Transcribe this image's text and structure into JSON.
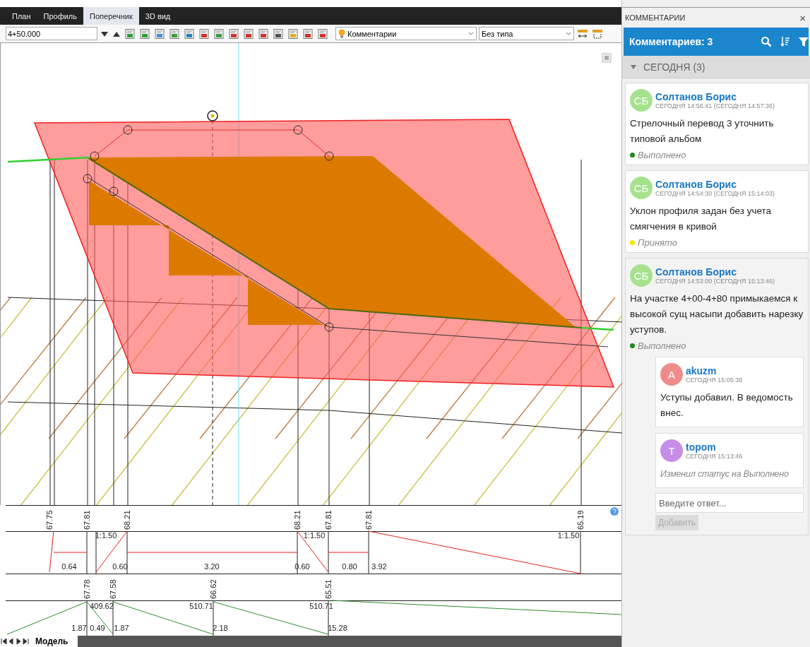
{
  "view_tabs": [
    {
      "label": "План",
      "selected": false
    },
    {
      "label": "Профиль",
      "selected": false
    },
    {
      "label": "Поперечник",
      "selected": true
    },
    {
      "label": "3D вид",
      "selected": false
    }
  ],
  "toolbar": {
    "station": "4+50.000",
    "layer_dropdown": "Комментарии",
    "type_dropdown": "Без типа"
  },
  "bands": [
    {
      "elevations": [
        "67.75",
        "67.81",
        "68.21",
        "68.21",
        "67.81",
        "67.81",
        "65.19"
      ],
      "slopes": [
        "1:1.50",
        "1:1.50",
        "1:1.50"
      ],
      "lengths": [
        "0.64",
        "0.60",
        "3.20",
        "0.60",
        "0.80",
        "3.92"
      ]
    },
    {
      "elevations": [
        "67.78",
        "67.58",
        "66.62",
        "65.51"
      ],
      "slopes": [
        "409.62",
        "510.71",
        "510.71"
      ],
      "lengths": [
        "1.87",
        "0.49",
        "1.87",
        "2.18",
        "15.28"
      ]
    }
  ],
  "sheet_tabs": [
    {
      "label": "Модель",
      "selected": true
    }
  ],
  "comments_panel": {
    "title": "КОММЕНТАРИИ",
    "close": "×",
    "count_label": "Комментариев: 3",
    "groups": [
      {
        "label": "СЕГОДНЯ (3)",
        "expanded": true,
        "comments": [
          {
            "initials": "СБ",
            "color": "#a6e28e",
            "author": "Солтанов Борис",
            "time": "СЕГОДНЯ 14:56:41 (СЕГОДНЯ 14:57:36)",
            "text": "Стрелочный перевод 3 уточнить типовой альбом",
            "status": {
              "text": "Выполнено",
              "color": "#1a8c1a"
            },
            "selected": false
          },
          {
            "initials": "СБ",
            "color": "#a6e28e",
            "author": "Солтанов Борис",
            "time": "СЕГОДНЯ 14:54:30 (СЕГОДНЯ 15:14:03)",
            "text": "Уклон профиля задан без учета смягчения в кривой",
            "status": {
              "text": "Принято",
              "color": "#f2e600"
            },
            "selected": false
          },
          {
            "initials": "СБ",
            "color": "#a6e28e",
            "author": "Солтанов Борис",
            "time": "СЕГОДНЯ 14:53:00 (СЕГОДНЯ 15:13:46)",
            "text": "На участке 4+00-4+80 примыкаемся к высокой сущ насыпи добавить нарезку уступов.",
            "status": {
              "text": "Выполнено",
              "color": "#1a8c1a"
            },
            "selected": true,
            "replies": [
              {
                "kind": "note",
                "initials": "A",
                "color": "#ee8c8c",
                "author": "akuzm",
                "time": "СЕГОДНЯ 15:05:38",
                "text": "Уступы добавил. В ведомость внес."
              },
              {
                "kind": "status_change",
                "initials": "T",
                "color": "#c58de8",
                "author": "topom",
                "time": "СЕГОДНЯ 15:13:46",
                "text": "Изменил статус на Выполнено"
              }
            ],
            "reply_box": {
              "placeholder": "Введите ответ...",
              "button": "Добавить",
              "disabled": true
            }
          }
        ]
      }
    ]
  }
}
